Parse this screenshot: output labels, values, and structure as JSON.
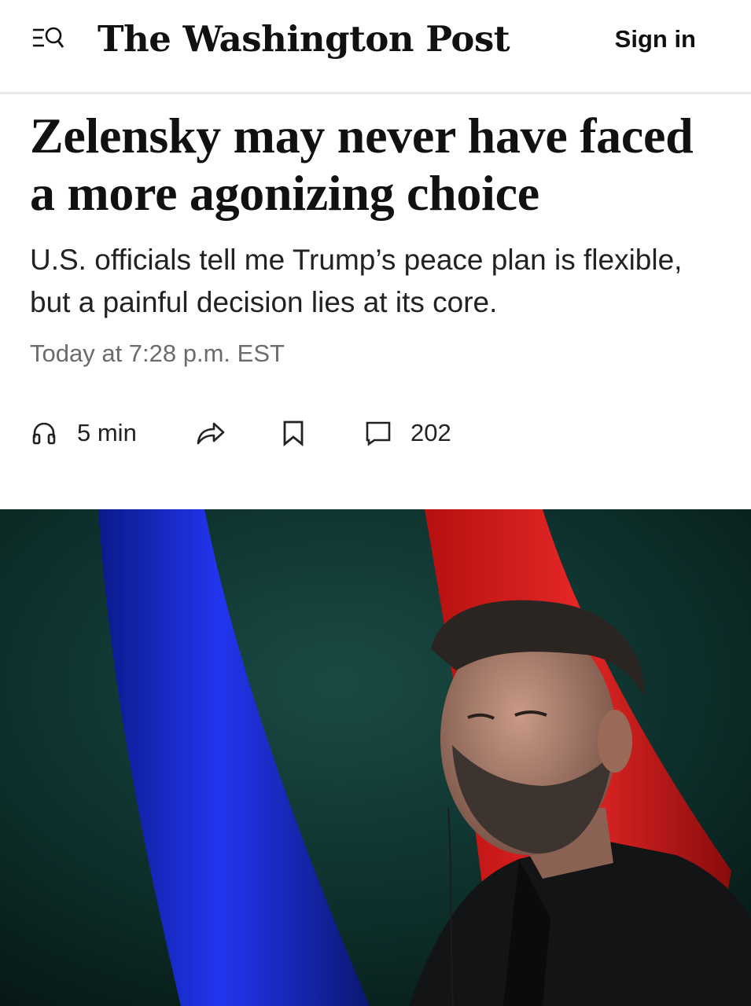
{
  "header": {
    "menu_icon": "menu-search-icon",
    "logo": "The Washington Post",
    "signin_label": "Sign in"
  },
  "article": {
    "headline": "Zelensky may never have faced a more agonizing choice",
    "dek": "U.S. officials tell me Trump’s peace plan is flexible, but a painful decision lies at its core.",
    "timestamp": "Today at 7:28 p.m. EST"
  },
  "actions": {
    "listen_icon": "headphones-icon",
    "listen_label": "5 min",
    "share_icon": "share-arrow-icon",
    "save_icon": "bookmark-icon",
    "comments_icon": "comment-bubble-icon",
    "comments_count": "202"
  },
  "photo": {
    "subject": "portrait of man in dark jacket",
    "background_colors": {
      "teal": "#0c2a26",
      "blue_flag": "#1a2fd6",
      "red_flag": "#d31c1c"
    }
  }
}
